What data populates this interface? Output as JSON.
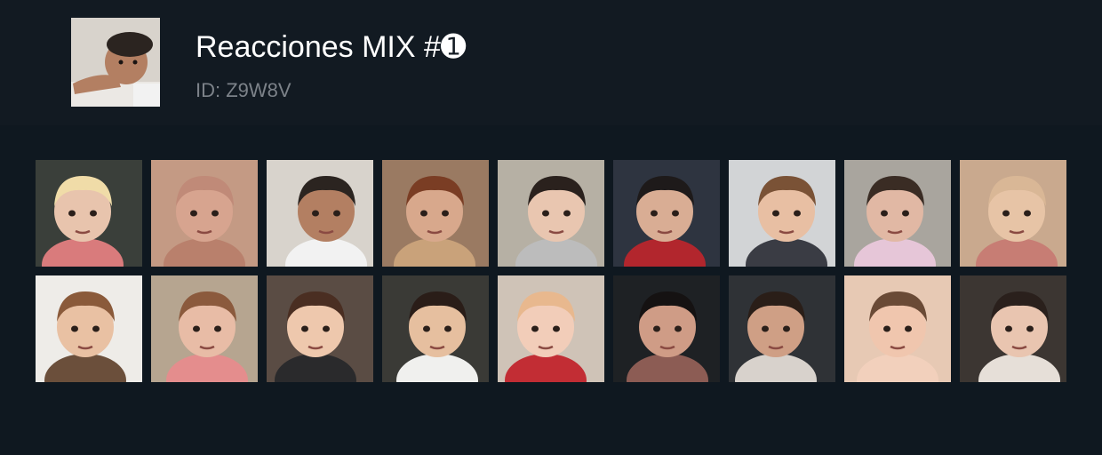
{
  "pack": {
    "title": "Reacciones MIX #➊",
    "id_text": "ID: Z9W8V",
    "cover_icon": "baby-face-sticker-icon"
  },
  "stickers": [
    {
      "icon": "baby-sticker-icon",
      "bg": "#3a3f3a",
      "skin": "#e8c4ad",
      "hair": "#f0dca8",
      "shirt": "#d97b7c"
    },
    {
      "icon": "baby-sticker-icon",
      "bg": "#c49a84",
      "skin": "#d7a48f",
      "hair": "#c08a78",
      "shirt": "#b9806c"
    },
    {
      "icon": "baby-sticker-icon",
      "bg": "#d8d3cc",
      "skin": "#b37f62",
      "hair": "#2b2420",
      "shirt": "#f2f2f2"
    },
    {
      "icon": "baby-sticker-icon",
      "bg": "#9a7a62",
      "skin": "#d8a88c",
      "hair": "#7a3d24",
      "shirt": "#c9a27a"
    },
    {
      "icon": "baby-sticker-icon",
      "bg": "#b6b0a4",
      "skin": "#e9c6b0",
      "hair": "#2a211d",
      "shirt": "#bcbcbc"
    },
    {
      "icon": "baby-sticker-icon",
      "bg": "#2e3440",
      "skin": "#d9ad94",
      "hair": "#1e1a1a",
      "shirt": "#b2262d"
    },
    {
      "icon": "baby-sticker-icon",
      "bg": "#d2d4d6",
      "skin": "#e8bfa3",
      "hair": "#7a5236",
      "shirt": "#3a3c44"
    },
    {
      "icon": "baby-sticker-icon",
      "bg": "#a9a59e",
      "skin": "#e1b8a4",
      "hair": "#3a2c24",
      "shirt": "#e6c6d8"
    },
    {
      "icon": "baby-sticker-icon",
      "bg": "#c9a98e",
      "skin": "#e7c4a6",
      "hair": "#d9b796",
      "shirt": "#c77d74"
    },
    {
      "icon": "baby-sticker-icon",
      "bg": "#eeece8",
      "skin": "#e9c1a3",
      "hair": "#8a5a3a",
      "shirt": "#6b4f3b"
    },
    {
      "icon": "baby-sticker-icon",
      "bg": "#b6a590",
      "skin": "#e8bca6",
      "hair": "#8b5a3d",
      "shirt": "#e48d8d"
    },
    {
      "icon": "baby-sticker-icon",
      "bg": "#5a4c44",
      "skin": "#eec8ad",
      "hair": "#4a2e22",
      "shirt": "#2a2a2c"
    },
    {
      "icon": "baby-sticker-icon",
      "bg": "#3a3a36",
      "skin": "#e6bf9f",
      "hair": "#2a1d18",
      "shirt": "#f0f0ee"
    },
    {
      "icon": "baby-sticker-icon",
      "bg": "#cfc3b7",
      "skin": "#f2cdb9",
      "hair": "#e8b88e",
      "shirt": "#c22d34"
    },
    {
      "icon": "baby-sticker-icon",
      "bg": "#1e2124",
      "skin": "#cf9c86",
      "hair": "#151212",
      "shirt": "#8c5c54"
    },
    {
      "icon": "baby-sticker-icon",
      "bg": "#2f3236",
      "skin": "#cf9f85",
      "hair": "#2a1e18",
      "shirt": "#d8d2cc"
    },
    {
      "icon": "baby-sticker-icon",
      "bg": "#e7c9b4",
      "skin": "#f0c6ae",
      "hair": "#6a4a36",
      "shirt": "#f2d0bc"
    },
    {
      "icon": "baby-sticker-icon",
      "bg": "#3c3632",
      "skin": "#e9c5b0",
      "hair": "#2a201c",
      "shirt": "#e6dfd8"
    }
  ]
}
